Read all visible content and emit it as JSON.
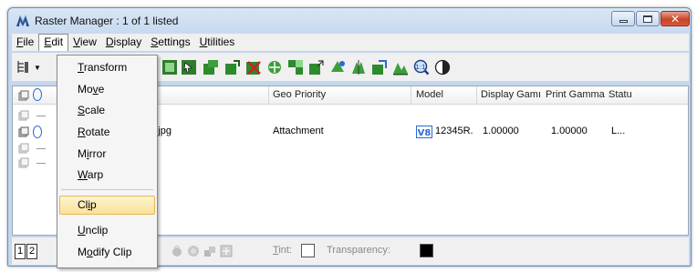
{
  "window": {
    "title": "Raster Manager : 1 of 1 listed"
  },
  "menubar": {
    "items": [
      {
        "label": "File",
        "accel": "F",
        "rest": "ile"
      },
      {
        "label": "Edit",
        "accel": "E",
        "rest": "dit"
      },
      {
        "label": "View",
        "accel": "V",
        "rest": "iew"
      },
      {
        "label": "Display",
        "accel": "D",
        "rest": "isplay"
      },
      {
        "label": "Settings",
        "accel": "S",
        "rest": "ettings"
      },
      {
        "label": "Utilities",
        "accel": "U",
        "rest": "tilities"
      }
    ]
  },
  "edit_menu": {
    "items": [
      {
        "label": "Transform",
        "accel": "T",
        "rest": "ransform"
      },
      {
        "label": "Move",
        "pre": "Mo",
        "accel": "v",
        "rest": "e"
      },
      {
        "label": "Scale",
        "accel": "S",
        "rest": "cale"
      },
      {
        "label": "Rotate",
        "accel": "R",
        "rest": "otate"
      },
      {
        "label": "Mirror",
        "pre": "M",
        "accel": "i",
        "rest": "rror"
      },
      {
        "label": "Warp",
        "accel": "W",
        "rest": "arp"
      },
      {
        "label": "Clip",
        "pre": "Cl",
        "accel": "i",
        "rest": "p",
        "highlighted": true
      },
      {
        "label": "Unclip",
        "accel": "U",
        "rest": "nclip"
      },
      {
        "label": "Modify Clip",
        "pre": "M",
        "accel": "o",
        "rest": "dify Clip"
      }
    ]
  },
  "grid": {
    "columns": [
      "Geo Priority",
      "Model",
      "Display Gamı",
      "Print Gamma",
      "Statu"
    ],
    "rows": [
      {
        "file": "ap.jpg",
        "geo_priority": "Attachment",
        "model": "12345R.",
        "display_gamma": "1.00000",
        "print_gamma": "1.00000",
        "status": "L..."
      }
    ]
  },
  "statusbar": {
    "pages": [
      "1",
      "2"
    ],
    "tint_label": "Tint:",
    "tint_accel": "T",
    "tint_rest": "int:",
    "transparency_label": "Transparency:"
  },
  "colors": {
    "menu_highlight": "#fbe29a",
    "close_button": "#c8452b",
    "title_gradient": "#c3d7ee"
  }
}
